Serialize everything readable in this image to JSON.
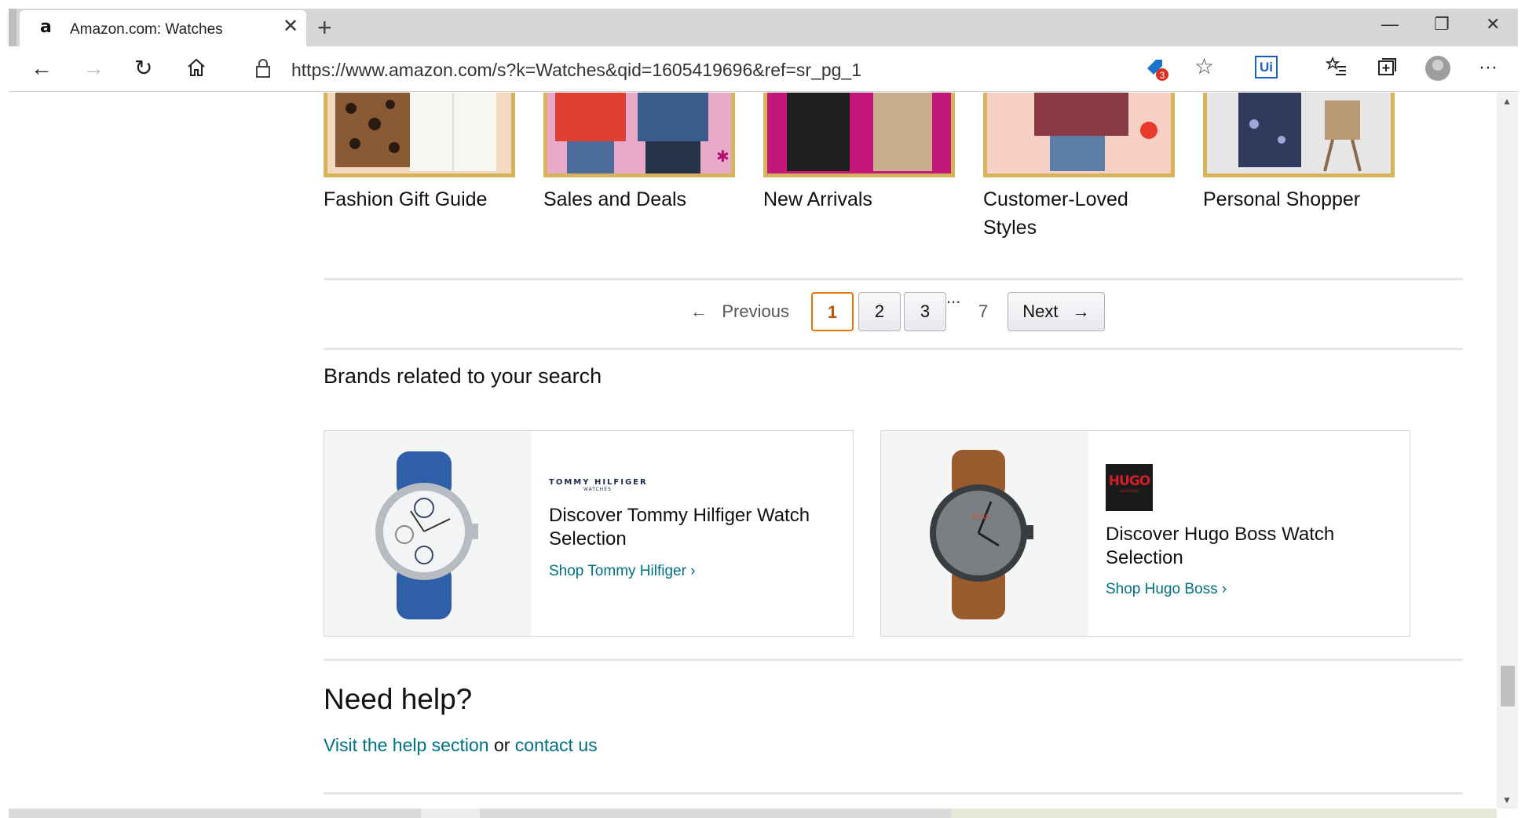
{
  "browser": {
    "tab_title": "Amazon.com: Watches",
    "favicon_letter": "a",
    "new_tab_symbol": "+",
    "url": "https://www.amazon.com/s?k=Watches&qid=1605419696&ref=sr_pg_1",
    "extension_badge_count": "3",
    "ui_extension_label": "Ui",
    "icons": [
      "back-icon",
      "forward-icon",
      "refresh-icon",
      "home-icon",
      "lock-icon",
      "extension-icon",
      "favorite-star-icon",
      "favorites-list-icon",
      "collections-icon",
      "profile-icon",
      "more-icon",
      "minimize-icon",
      "restore-icon",
      "close-window-icon"
    ]
  },
  "categories": [
    {
      "label": "Fashion Gift Guide",
      "color": "#f2c7a8"
    },
    {
      "label": "Sales and Deals",
      "color": "#e9a9c9"
    },
    {
      "label": "New Arrivals",
      "color": "#c4177a"
    },
    {
      "label": "Customer-Loved Styles",
      "color": "#f6cfc5"
    },
    {
      "label": "Personal Shopper",
      "color": "#e6e6e6"
    }
  ],
  "pagination": {
    "previous_label": "Previous",
    "pages": [
      "1",
      "2",
      "3"
    ],
    "ellipsis": "...",
    "last_page": "7",
    "next_label": "Next",
    "current": "1"
  },
  "brands": {
    "heading": "Brands related to your search",
    "items": [
      {
        "logo_text": "TOMMY HILFIGER",
        "logo_subtext": "WATCHES",
        "title": "Discover Tommy Hilfiger Watch Selection",
        "link": "Shop Tommy Hilfiger",
        "strap_color": "#2f5fa8"
      },
      {
        "logo_text": "HUGO",
        "logo_subtext": "HUGO BOSS",
        "title": "Discover Hugo Boss Watch Selection",
        "link": "Shop Hugo Boss",
        "strap_color": "#9a5b2e"
      }
    ]
  },
  "help": {
    "heading": "Need help?",
    "link1": "Visit the help section",
    "or": "or",
    "link2": "contact us"
  }
}
